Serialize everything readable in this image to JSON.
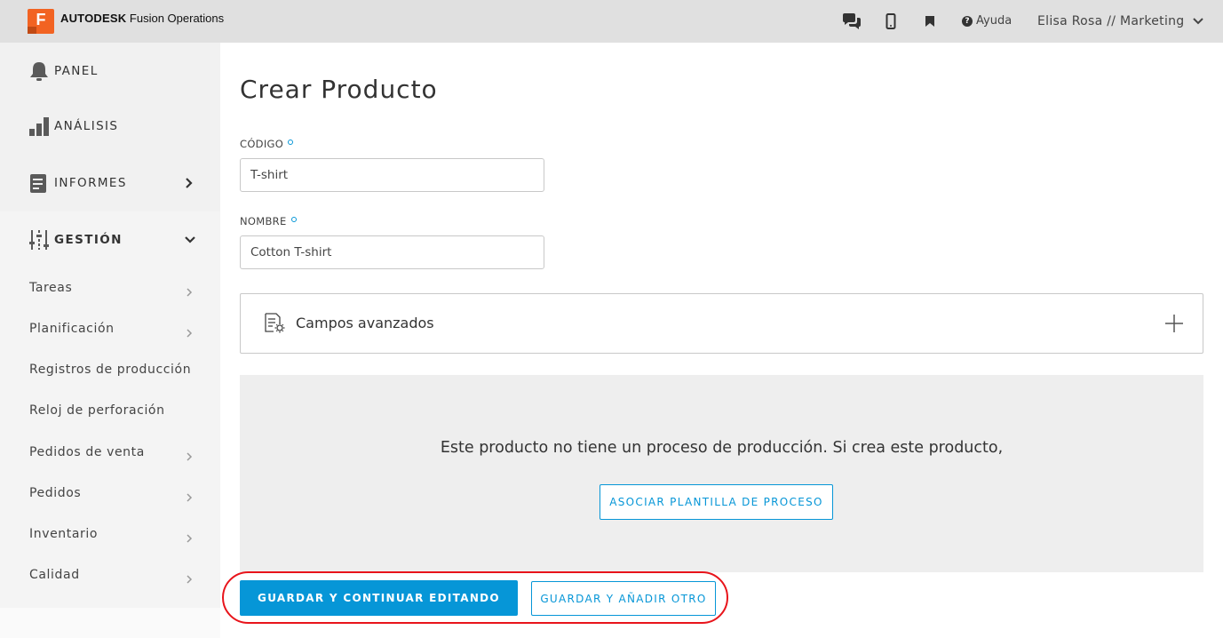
{
  "header": {
    "logo_letter": "F",
    "brand_bold": "AUTODESK",
    "brand_rest": " Fusion Operations",
    "icons": [
      "chat-icon",
      "mobile-icon",
      "bookmark-icon"
    ],
    "help_label": "Ayuda",
    "user_label": "Elisa Rosa // Marketing"
  },
  "sidebar": {
    "main_items": [
      {
        "label": "PANEL",
        "icon": "bell-icon"
      },
      {
        "label": "ANÁLISIS",
        "icon": "bar-chart-icon"
      },
      {
        "label": "INFORMES",
        "icon": "report-icon"
      },
      {
        "label": "GESTIÓN",
        "icon": "sliders-icon"
      }
    ],
    "sub_items": [
      {
        "label": "Tareas"
      },
      {
        "label": "Planificación"
      },
      {
        "label": "Registros de producción"
      },
      {
        "label": "Reloj de perforación"
      },
      {
        "label": "Pedidos de venta"
      },
      {
        "label": "Pedidos"
      },
      {
        "label": "Inventario"
      },
      {
        "label": "Calidad"
      }
    ]
  },
  "main": {
    "title": "Crear Producto",
    "code_label": "CÓDIGO",
    "code_value": "T-shirt",
    "name_label": "NOMBRE",
    "name_value": "Cotton T-shirt",
    "advanced_label": "Campos avanzados",
    "process_message": "Este producto no tiene un proceso de producción. Si crea este producto,",
    "associate_button": "ASOCIAR PLANTILLA DE PROCESO",
    "save_continue_button": "GUARDAR Y CONTINUAR EDITANDO",
    "save_add_button": "GUARDAR Y AÑADIR OTRO"
  },
  "colors": {
    "accent": "#0696d7",
    "brand": "#f26322",
    "highlight": "#e8141b"
  }
}
